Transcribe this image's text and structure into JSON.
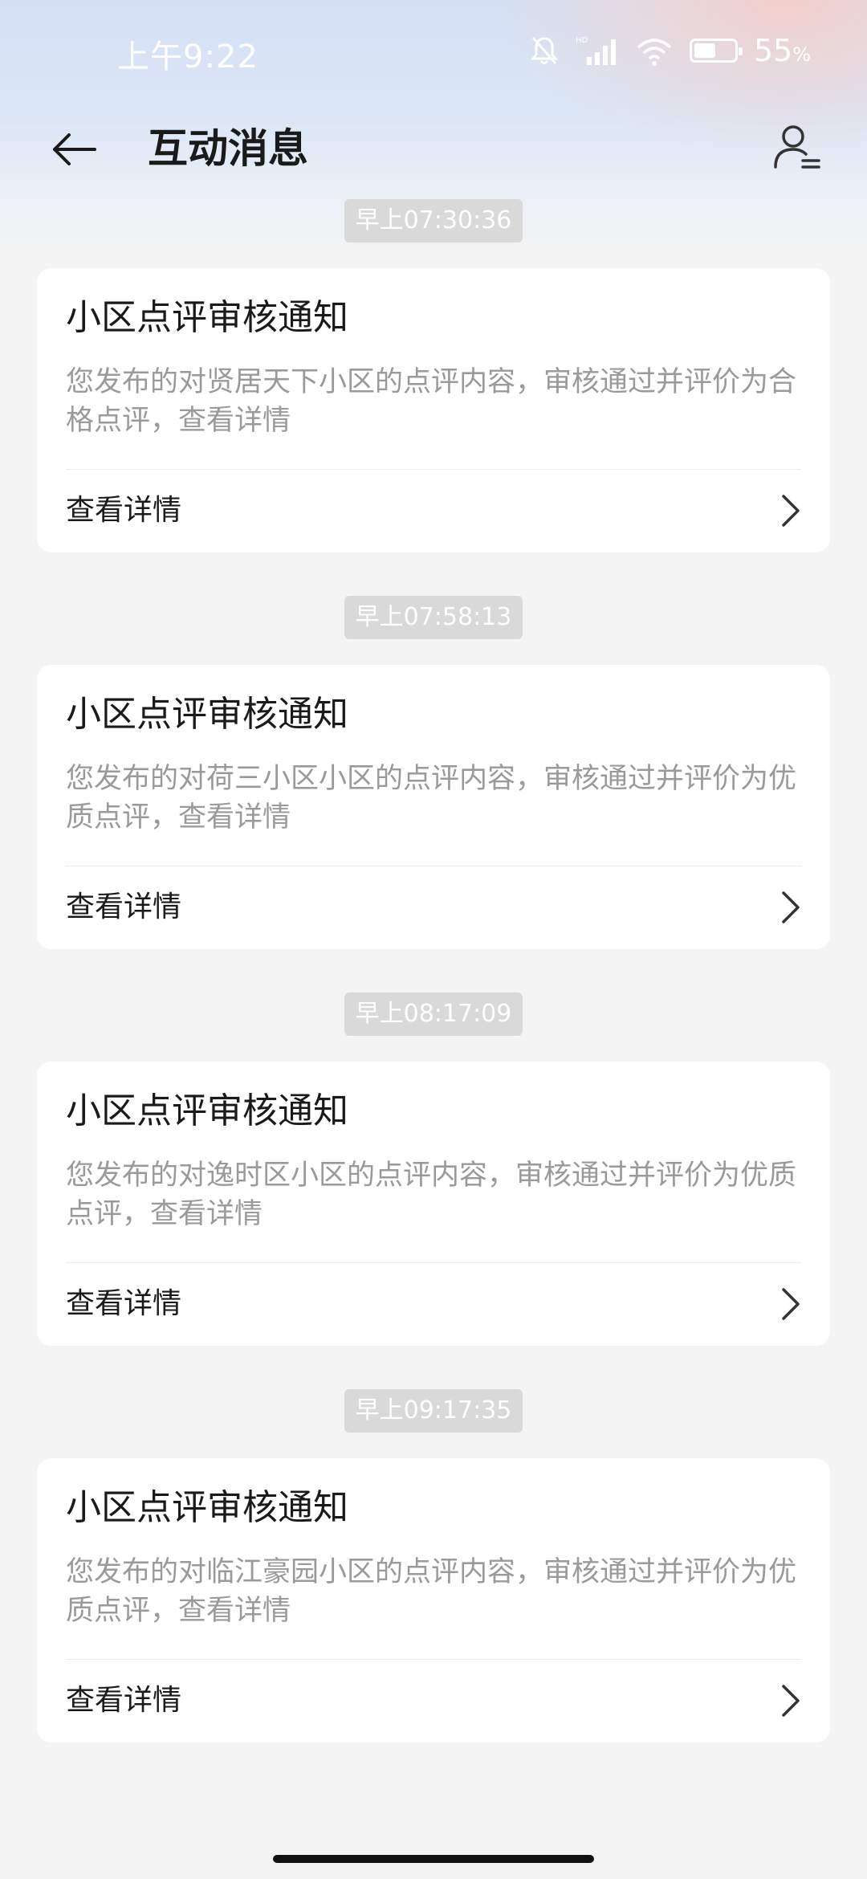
{
  "status_bar": {
    "time": "上午9:22",
    "battery_percent": "55",
    "battery_unit": "%",
    "battery_level": 0.55,
    "icons": [
      "bell-muted-icon",
      "hd-signal-icon",
      "wifi-icon",
      "battery-icon"
    ]
  },
  "header": {
    "title": "互动消息",
    "back_icon": "back-arrow-icon",
    "profile_icon": "user-settings-icon"
  },
  "messages": [
    {
      "timestamp": "早上07:30:36",
      "title": "小区点评审核通知",
      "body": "您发布的对贤居天下小区的点评内容，审核通过并评价为合格点评，查看详情",
      "action": "查看详情"
    },
    {
      "timestamp": "早上07:58:13",
      "title": "小区点评审核通知",
      "body": "您发布的对荷三小区小区的点评内容，审核通过并评价为优质点评，查看详情",
      "action": "查看详情"
    },
    {
      "timestamp": "早上08:17:09",
      "title": "小区点评审核通知",
      "body": "您发布的对逸时区小区的点评内容，审核通过并评价为优质点评，查看详情",
      "action": "查看详情"
    },
    {
      "timestamp": "早上09:17:35",
      "title": "小区点评审核通知",
      "body": "您发布的对临江豪园小区的点评内容，审核通过并评价为优质点评，查看详情",
      "action": "查看详情"
    }
  ]
}
